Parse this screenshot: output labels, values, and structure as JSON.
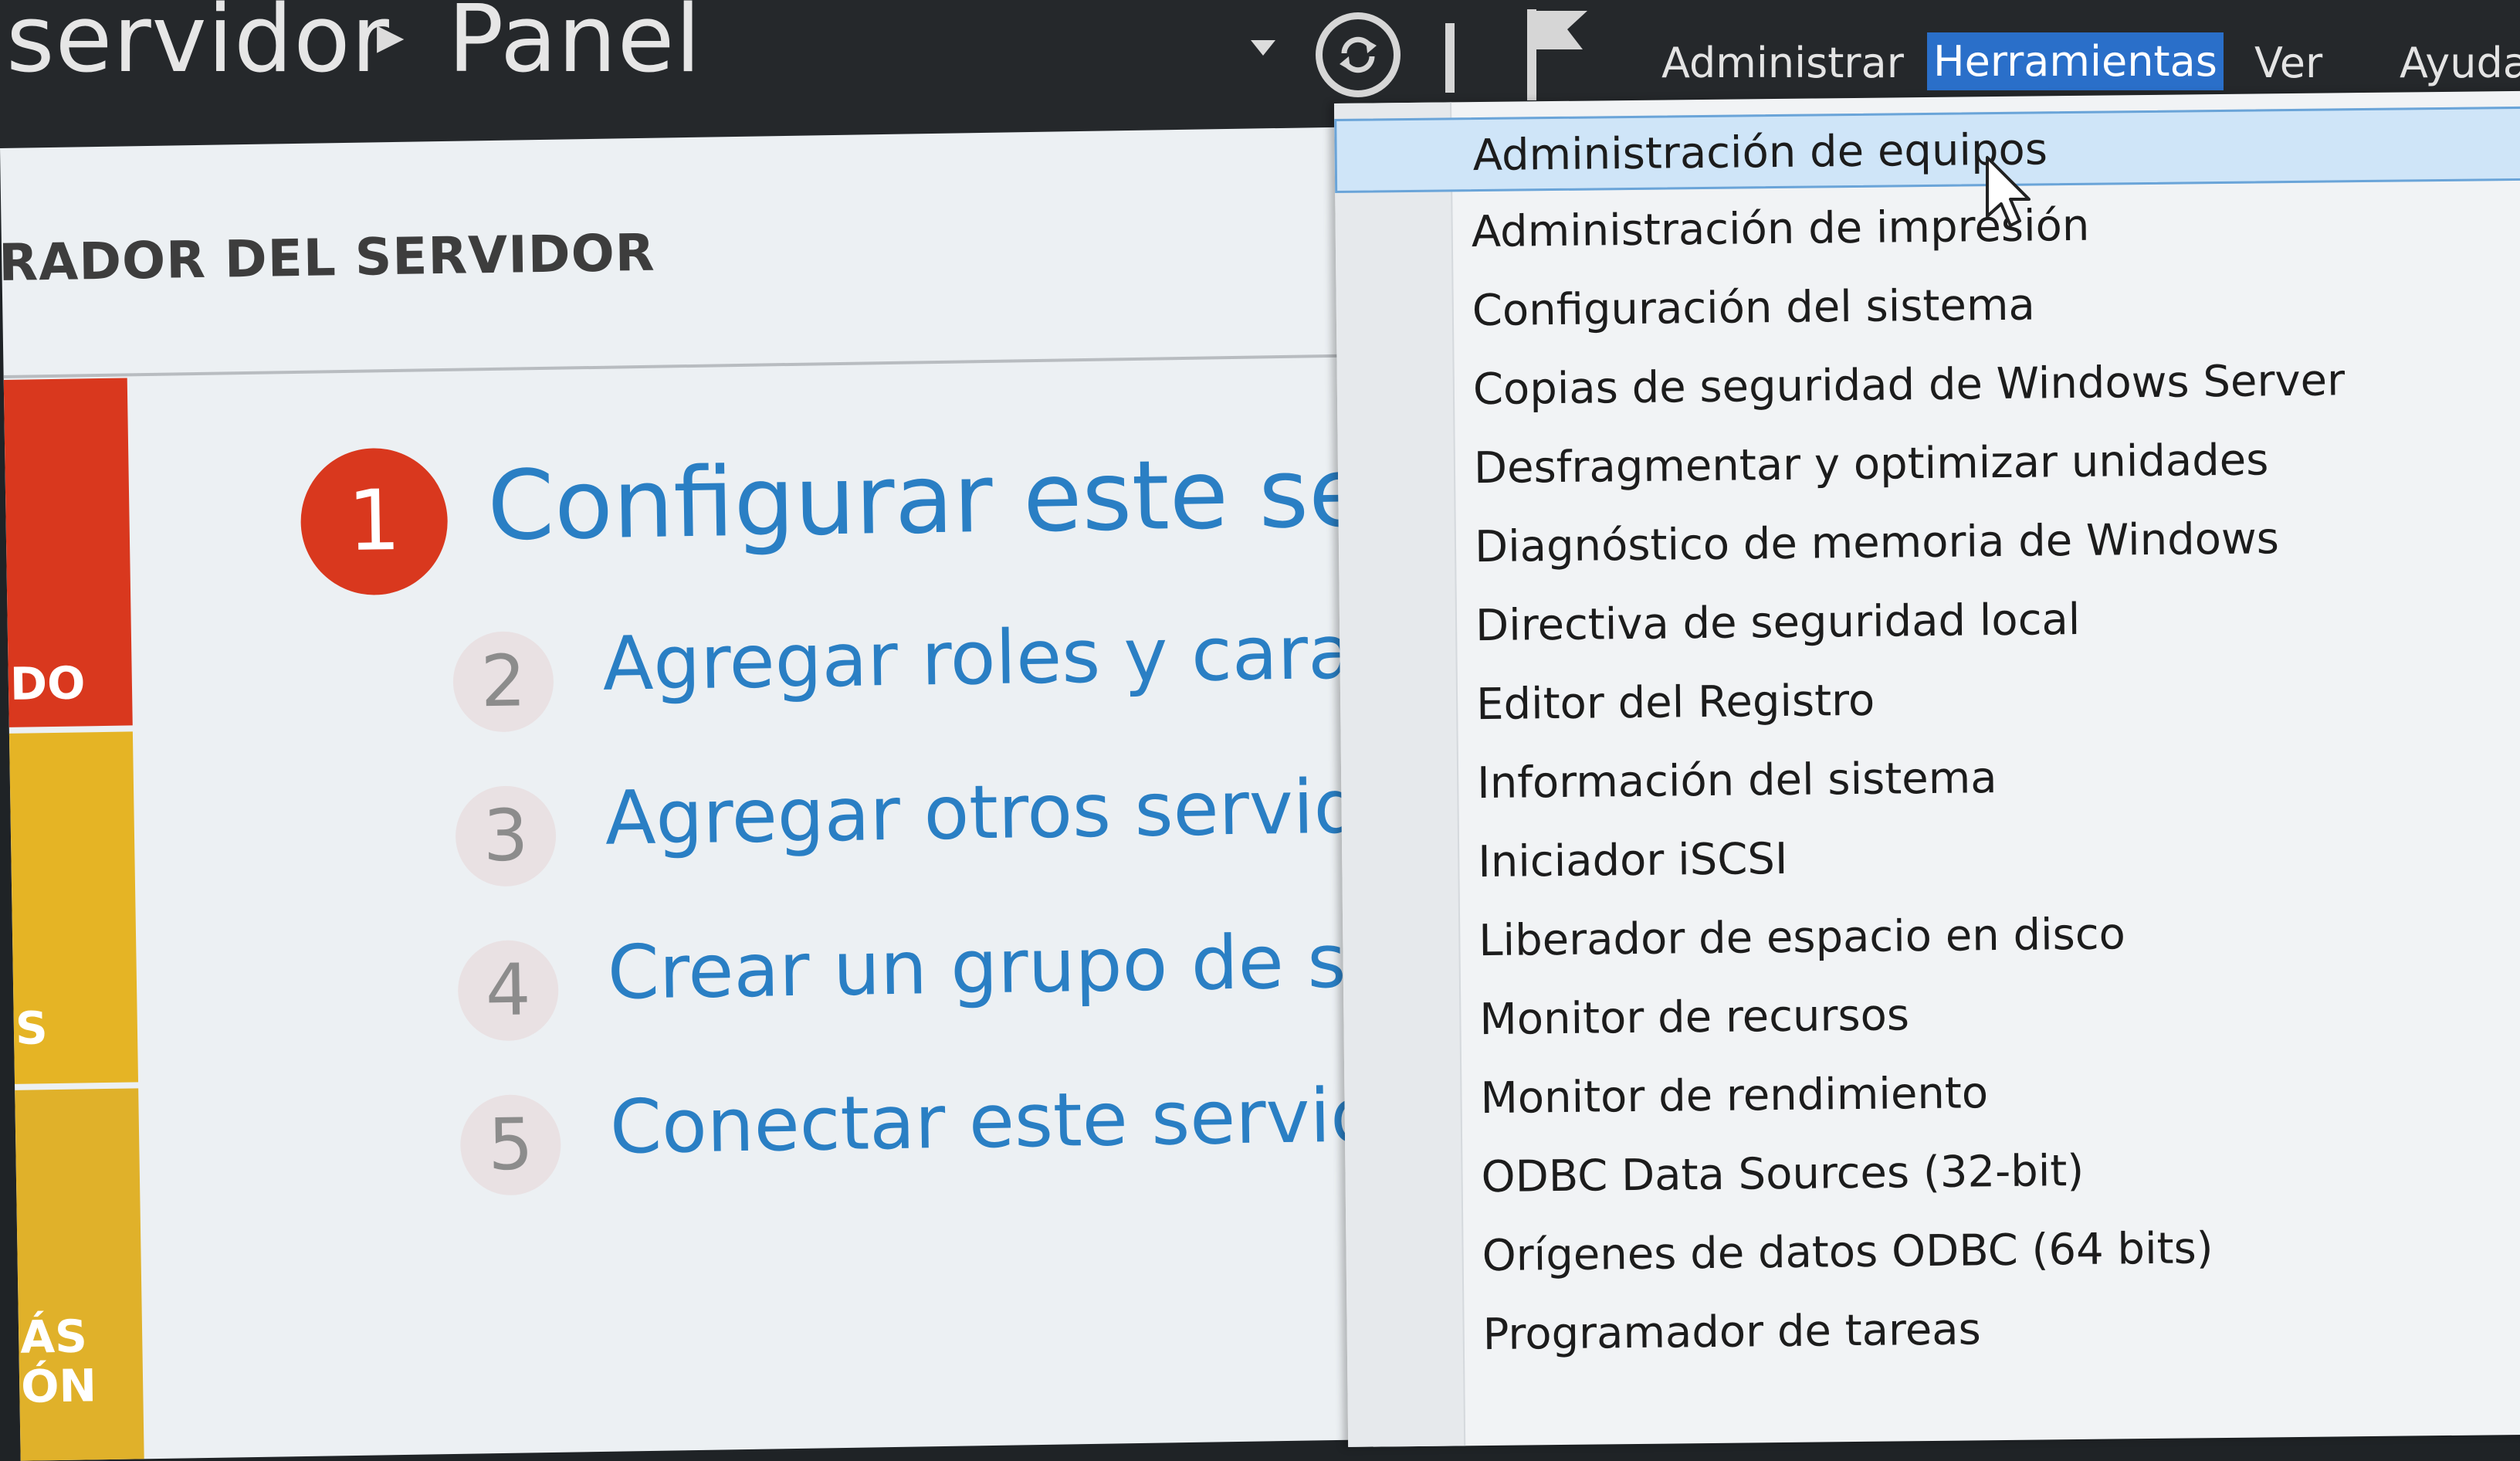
{
  "header": {
    "crumb_1": "servidor",
    "crumb_2": "Panel",
    "refresh_icon": "refresh-icon",
    "flag_icon": "flag-icon",
    "menus": [
      "Administrar",
      "Herramientas",
      "Ver",
      "Ayuda"
    ],
    "active_menu": "Herramientas",
    "accent_color": "#2a6fc9"
  },
  "dashboard": {
    "heading": "RADOR DEL SERVIDOR",
    "tiles": [
      "DO",
      "S",
      "ÁS",
      "ÓN"
    ],
    "tile_colors": [
      "#d9381e",
      "#e5b425",
      "#e0b12a"
    ],
    "quick_start": {
      "number": "1",
      "title": "Configurar este servido"
    },
    "steps": [
      {
        "number": "2",
        "text": "Agregar roles y caracterís"
      },
      {
        "number": "3",
        "text": "Agregar otros servidores"
      },
      {
        "number": "4",
        "text": "Crear un grupo de servid"
      },
      {
        "number": "5",
        "text": "Conectar este servidor a s"
      }
    ]
  },
  "tools_menu": {
    "hovered_item": "Administración de equipos",
    "items": [
      "Administración de equipos",
      "Administración de impresión",
      "Configuración del sistema",
      "Copias de seguridad de Windows Server",
      "Desfragmentar y optimizar unidades",
      "Diagnóstico de memoria de Windows",
      "Directiva de seguridad local",
      "Editor del Registro",
      "Información del sistema",
      "Iniciador iSCSI",
      "Liberador de espacio en disco",
      "Monitor de recursos",
      "Monitor de rendimiento",
      "ODBC Data Sources (32-bit)",
      "Orígenes de datos ODBC (64 bits)",
      "Programador de tareas"
    ]
  },
  "cursor_icon": "mouse-pointer-icon"
}
